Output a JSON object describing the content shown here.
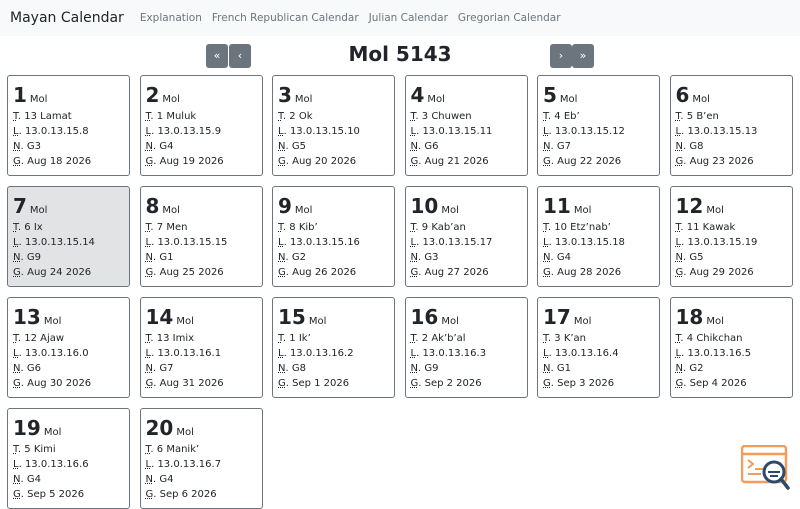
{
  "navbar": {
    "brand": "Mayan Calendar",
    "links": [
      "Explanation",
      "French Republican Calendar",
      "Julian Calendar",
      "Gregorian Calendar"
    ]
  },
  "header": {
    "title": "Mol 5143",
    "prev_year": "«",
    "prev_month": "‹",
    "next_month": "›",
    "next_year": "»"
  },
  "labels": {
    "tzolkin": "T",
    "long_count": "L",
    "lord_of_night": "N",
    "gregorian": "G"
  },
  "colors": {
    "navbar_bg": "#f8f9fa",
    "button_bg": "#6c757d",
    "today_bg": "#e2e3e5",
    "card_border": "#6c757d",
    "icon_orange": "#f39c5a",
    "icon_blue": "#2c4a6e"
  },
  "helper_icon": "search-code-icon",
  "today_index": 6,
  "days": [
    {
      "num": "1",
      "month": "Mol",
      "t": "13 Lamat",
      "l": "13.0.13.15.8",
      "n": "G3",
      "g": "Aug 18 2026"
    },
    {
      "num": "2",
      "month": "Mol",
      "t": "1 Muluk",
      "l": "13.0.13.15.9",
      "n": "G4",
      "g": "Aug 19 2026"
    },
    {
      "num": "3",
      "month": "Mol",
      "t": "2 Ok",
      "l": "13.0.13.15.10",
      "n": "G5",
      "g": "Aug 20 2026"
    },
    {
      "num": "4",
      "month": "Mol",
      "t": "3 Chuwen",
      "l": "13.0.13.15.11",
      "n": "G6",
      "g": "Aug 21 2026"
    },
    {
      "num": "5",
      "month": "Mol",
      "t": "4 Eb’",
      "l": "13.0.13.15.12",
      "n": "G7",
      "g": "Aug 22 2026"
    },
    {
      "num": "6",
      "month": "Mol",
      "t": "5 B’en",
      "l": "13.0.13.15.13",
      "n": "G8",
      "g": "Aug 23 2026"
    },
    {
      "num": "7",
      "month": "Mol",
      "t": "6 Ix",
      "l": "13.0.13.15.14",
      "n": "G9",
      "g": "Aug 24 2026"
    },
    {
      "num": "8",
      "month": "Mol",
      "t": "7 Men",
      "l": "13.0.13.15.15",
      "n": "G1",
      "g": "Aug 25 2026"
    },
    {
      "num": "9",
      "month": "Mol",
      "t": "8 Kib’",
      "l": "13.0.13.15.16",
      "n": "G2",
      "g": "Aug 26 2026"
    },
    {
      "num": "10",
      "month": "Mol",
      "t": "9 Kab’an",
      "l": "13.0.13.15.17",
      "n": "G3",
      "g": "Aug 27 2026"
    },
    {
      "num": "11",
      "month": "Mol",
      "t": "10 Etz’nab’",
      "l": "13.0.13.15.18",
      "n": "G4",
      "g": "Aug 28 2026"
    },
    {
      "num": "12",
      "month": "Mol",
      "t": "11 Kawak",
      "l": "13.0.13.15.19",
      "n": "G5",
      "g": "Aug 29 2026"
    },
    {
      "num": "13",
      "month": "Mol",
      "t": "12 Ajaw",
      "l": "13.0.13.16.0",
      "n": "G6",
      "g": "Aug 30 2026"
    },
    {
      "num": "14",
      "month": "Mol",
      "t": "13 Imix",
      "l": "13.0.13.16.1",
      "n": "G7",
      "g": "Aug 31 2026"
    },
    {
      "num": "15",
      "month": "Mol",
      "t": "1 Ik’",
      "l": "13.0.13.16.2",
      "n": "G8",
      "g": "Sep 1 2026"
    },
    {
      "num": "16",
      "month": "Mol",
      "t": "2 Ak’b’al",
      "l": "13.0.13.16.3",
      "n": "G9",
      "g": "Sep 2 2026"
    },
    {
      "num": "17",
      "month": "Mol",
      "t": "3 K’an",
      "l": "13.0.13.16.4",
      "n": "G1",
      "g": "Sep 3 2026"
    },
    {
      "num": "18",
      "month": "Mol",
      "t": "4 Chikchan",
      "l": "13.0.13.16.5",
      "n": "G2",
      "g": "Sep 4 2026"
    },
    {
      "num": "19",
      "month": "Mol",
      "t": "5 Kimi",
      "l": "13.0.13.16.6",
      "n": "G4",
      "g": "Sep 5 2026"
    },
    {
      "num": "20",
      "month": "Mol",
      "t": "6 Manik’",
      "l": "13.0.13.16.7",
      "n": "G4",
      "g": "Sep 6 2026"
    }
  ]
}
